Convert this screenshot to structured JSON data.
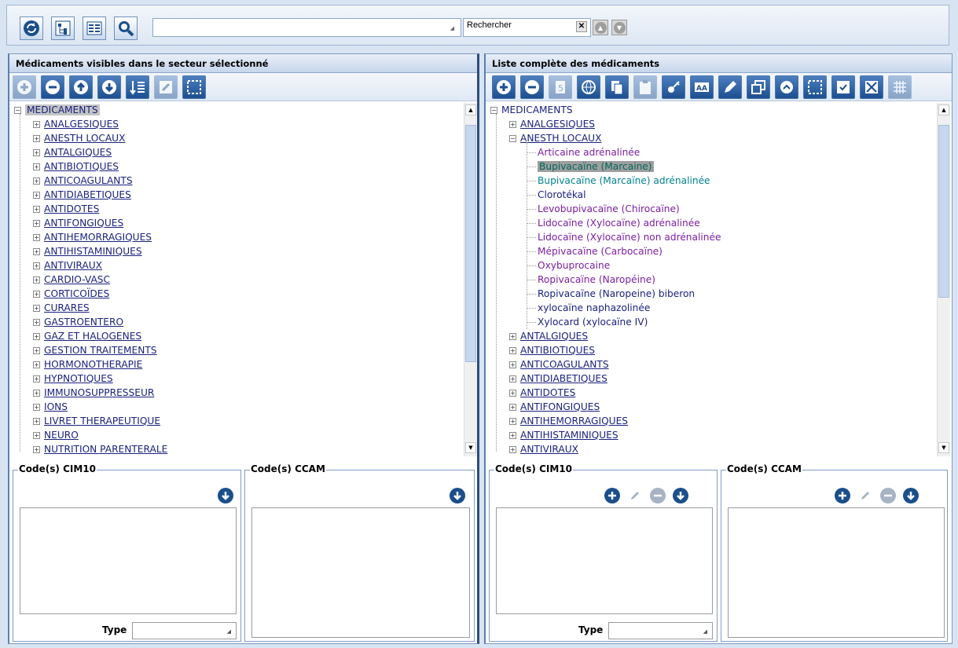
{
  "toolbar": {
    "buttons": [
      "refresh-icon",
      "tree-expand-icon",
      "compare-icon",
      "search-zoom-icon"
    ],
    "combo_value": "",
    "search_placeholder": "Rechercher"
  },
  "left_panel": {
    "title": "Médicaments visibles dans le secteur sélectionné",
    "tools": [
      "add-icon",
      "remove-icon",
      "move-up-icon",
      "move-down-icon",
      "sort-icon",
      "edit-icon",
      "select-icon"
    ],
    "tree_root": "MEDICAMENTS",
    "tree_items": [
      "ANALGESIQUES",
      "ANESTH LOCAUX",
      "ANTALGIQUES",
      "ANTIBIOTIQUES",
      "ANTICOAGULANTS",
      "ANTIDIABETIQUES",
      "ANTIDOTES",
      "ANTIFONGIQUES",
      "ANTIHEMORRAGIQUES",
      "ANTIHISTAMINIQUES",
      "ANTIVIRAUX",
      "CARDIO-VASC",
      "CORTICOÏDES",
      "CURARES",
      "GASTROENTERO",
      "GAZ ET HALOGENES",
      "GESTION TRAITEMENTS",
      "HORMONOTHERAPIE",
      "HYPNOTIQUES",
      "IMMUNOSUPPRESSEUR",
      "IONS",
      "LIVRET THERAPEUTIQUE",
      "NEURO",
      "NUTRITION PARENTERALE"
    ],
    "cim10_label": "Code(s) CIM10",
    "ccam_label": "Code(s) CCAM",
    "type_label": "Type",
    "type_value": ""
  },
  "right_panel": {
    "title": "Liste complète des médicaments",
    "tools": [
      "add-icon",
      "remove-icon",
      "number-icon",
      "globe-icon",
      "copy-icon",
      "paste-icon",
      "key-icon",
      "font-icon",
      "edit-icon",
      "windows-icon",
      "link-icon",
      "select-icon",
      "check-icon",
      "delete-icon",
      "grid-icon"
    ],
    "tree_root": "MEDICAMENTS",
    "tree_items_before": [
      "ANALGESIQUES"
    ],
    "expanded_item": "ANESTH LOCAUX",
    "children": [
      {
        "label": "Articaine adrénalinée",
        "color": "purple"
      },
      {
        "label": "Bupivacaïne (Marcaine)",
        "color": "selected"
      },
      {
        "label": "Bupivacaïne (Marcaïne) adrénalinée",
        "color": "teal"
      },
      {
        "label": "Clorotékal",
        "color": "navy"
      },
      {
        "label": "Levobupivacaïne (Chirocaïne)",
        "color": "purple"
      },
      {
        "label": "Lidocaïne (Xylocaïne) adrénalinée",
        "color": "purple"
      },
      {
        "label": "Lidocaïne (Xylocaïne) non adrénalinée",
        "color": "purple"
      },
      {
        "label": "Mépivacaïne (Carbocaïne)",
        "color": "purple"
      },
      {
        "label": "Oxybuprocaine",
        "color": "purple"
      },
      {
        "label": "Ropivacaïne (Naropéine)",
        "color": "purple"
      },
      {
        "label": "Ropivacaïne (Naropeine) biberon",
        "color": "navy"
      },
      {
        "label": "xylocaïne naphazolinée",
        "color": "navy"
      },
      {
        "label": "Xylocard (xylocaïne IV)",
        "color": "navy"
      }
    ],
    "tree_items_after": [
      "ANTALGIQUES",
      "ANTIBIOTIQUES",
      "ANTICOAGULANTS",
      "ANTIDIABETIQUES",
      "ANTIDOTES",
      "ANTIFONGIQUES",
      "ANTIHEMORRAGIQUES",
      "ANTIHISTAMINIQUES",
      "ANTIVIRAUX"
    ],
    "cim10_label": "Code(s) CIM10",
    "ccam_label": "Code(s) CCAM",
    "type_label": "Type",
    "type_value": ""
  },
  "colors": {
    "accent": "#1b4f8c",
    "link": "#1a237e",
    "leaf_purple": "#7b1fa2",
    "leaf_teal": "#00838f"
  }
}
